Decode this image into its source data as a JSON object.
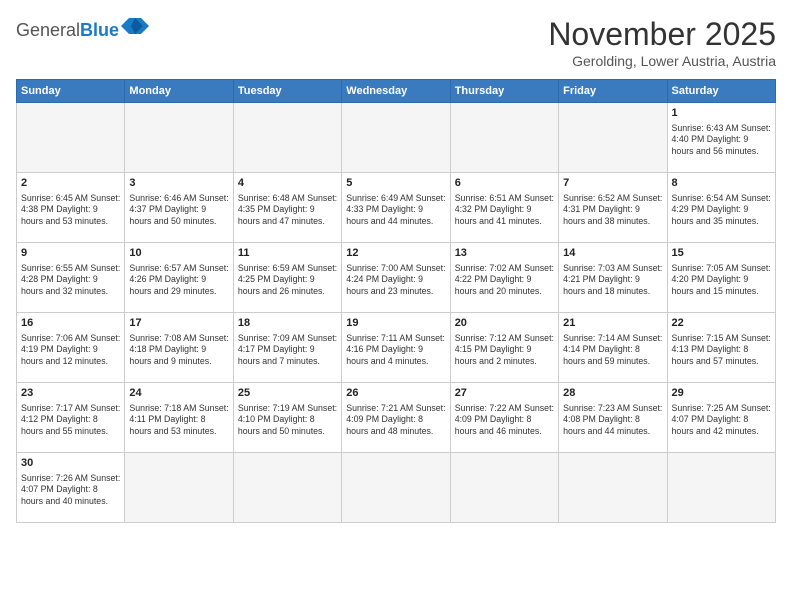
{
  "header": {
    "logo_general": "General",
    "logo_blue": "Blue",
    "month_title": "November 2025",
    "subtitle": "Gerolding, Lower Austria, Austria"
  },
  "weekdays": [
    "Sunday",
    "Monday",
    "Tuesday",
    "Wednesday",
    "Thursday",
    "Friday",
    "Saturday"
  ],
  "weeks": [
    [
      {
        "day": "",
        "info": ""
      },
      {
        "day": "",
        "info": ""
      },
      {
        "day": "",
        "info": ""
      },
      {
        "day": "",
        "info": ""
      },
      {
        "day": "",
        "info": ""
      },
      {
        "day": "",
        "info": ""
      },
      {
        "day": "1",
        "info": "Sunrise: 6:43 AM\nSunset: 4:40 PM\nDaylight: 9 hours and 56 minutes."
      }
    ],
    [
      {
        "day": "2",
        "info": "Sunrise: 6:45 AM\nSunset: 4:38 PM\nDaylight: 9 hours and 53 minutes."
      },
      {
        "day": "3",
        "info": "Sunrise: 6:46 AM\nSunset: 4:37 PM\nDaylight: 9 hours and 50 minutes."
      },
      {
        "day": "4",
        "info": "Sunrise: 6:48 AM\nSunset: 4:35 PM\nDaylight: 9 hours and 47 minutes."
      },
      {
        "day": "5",
        "info": "Sunrise: 6:49 AM\nSunset: 4:33 PM\nDaylight: 9 hours and 44 minutes."
      },
      {
        "day": "6",
        "info": "Sunrise: 6:51 AM\nSunset: 4:32 PM\nDaylight: 9 hours and 41 minutes."
      },
      {
        "day": "7",
        "info": "Sunrise: 6:52 AM\nSunset: 4:31 PM\nDaylight: 9 hours and 38 minutes."
      },
      {
        "day": "8",
        "info": "Sunrise: 6:54 AM\nSunset: 4:29 PM\nDaylight: 9 hours and 35 minutes."
      }
    ],
    [
      {
        "day": "9",
        "info": "Sunrise: 6:55 AM\nSunset: 4:28 PM\nDaylight: 9 hours and 32 minutes."
      },
      {
        "day": "10",
        "info": "Sunrise: 6:57 AM\nSunset: 4:26 PM\nDaylight: 9 hours and 29 minutes."
      },
      {
        "day": "11",
        "info": "Sunrise: 6:59 AM\nSunset: 4:25 PM\nDaylight: 9 hours and 26 minutes."
      },
      {
        "day": "12",
        "info": "Sunrise: 7:00 AM\nSunset: 4:24 PM\nDaylight: 9 hours and 23 minutes."
      },
      {
        "day": "13",
        "info": "Sunrise: 7:02 AM\nSunset: 4:22 PM\nDaylight: 9 hours and 20 minutes."
      },
      {
        "day": "14",
        "info": "Sunrise: 7:03 AM\nSunset: 4:21 PM\nDaylight: 9 hours and 18 minutes."
      },
      {
        "day": "15",
        "info": "Sunrise: 7:05 AM\nSunset: 4:20 PM\nDaylight: 9 hours and 15 minutes."
      }
    ],
    [
      {
        "day": "16",
        "info": "Sunrise: 7:06 AM\nSunset: 4:19 PM\nDaylight: 9 hours and 12 minutes."
      },
      {
        "day": "17",
        "info": "Sunrise: 7:08 AM\nSunset: 4:18 PM\nDaylight: 9 hours and 9 minutes."
      },
      {
        "day": "18",
        "info": "Sunrise: 7:09 AM\nSunset: 4:17 PM\nDaylight: 9 hours and 7 minutes."
      },
      {
        "day": "19",
        "info": "Sunrise: 7:11 AM\nSunset: 4:16 PM\nDaylight: 9 hours and 4 minutes."
      },
      {
        "day": "20",
        "info": "Sunrise: 7:12 AM\nSunset: 4:15 PM\nDaylight: 9 hours and 2 minutes."
      },
      {
        "day": "21",
        "info": "Sunrise: 7:14 AM\nSunset: 4:14 PM\nDaylight: 8 hours and 59 minutes."
      },
      {
        "day": "22",
        "info": "Sunrise: 7:15 AM\nSunset: 4:13 PM\nDaylight: 8 hours and 57 minutes."
      }
    ],
    [
      {
        "day": "23",
        "info": "Sunrise: 7:17 AM\nSunset: 4:12 PM\nDaylight: 8 hours and 55 minutes."
      },
      {
        "day": "24",
        "info": "Sunrise: 7:18 AM\nSunset: 4:11 PM\nDaylight: 8 hours and 53 minutes."
      },
      {
        "day": "25",
        "info": "Sunrise: 7:19 AM\nSunset: 4:10 PM\nDaylight: 8 hours and 50 minutes."
      },
      {
        "day": "26",
        "info": "Sunrise: 7:21 AM\nSunset: 4:09 PM\nDaylight: 8 hours and 48 minutes."
      },
      {
        "day": "27",
        "info": "Sunrise: 7:22 AM\nSunset: 4:09 PM\nDaylight: 8 hours and 46 minutes."
      },
      {
        "day": "28",
        "info": "Sunrise: 7:23 AM\nSunset: 4:08 PM\nDaylight: 8 hours and 44 minutes."
      },
      {
        "day": "29",
        "info": "Sunrise: 7:25 AM\nSunset: 4:07 PM\nDaylight: 8 hours and 42 minutes."
      }
    ],
    [
      {
        "day": "30",
        "info": "Sunrise: 7:26 AM\nSunset: 4:07 PM\nDaylight: 8 hours and 40 minutes."
      },
      {
        "day": "",
        "info": ""
      },
      {
        "day": "",
        "info": ""
      },
      {
        "day": "",
        "info": ""
      },
      {
        "day": "",
        "info": ""
      },
      {
        "day": "",
        "info": ""
      },
      {
        "day": "",
        "info": ""
      }
    ]
  ]
}
